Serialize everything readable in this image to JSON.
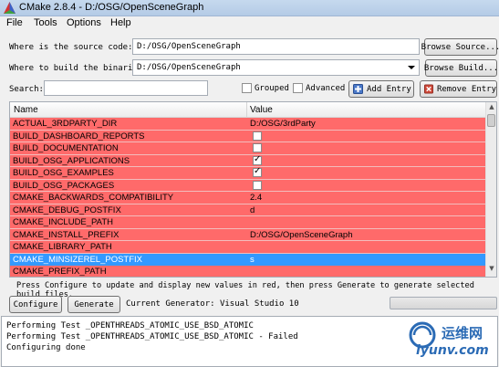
{
  "window": {
    "title": "CMake 2.8.4 - D:/OSG/OpenSceneGraph"
  },
  "menu": [
    "File",
    "Tools",
    "Options",
    "Help"
  ],
  "source": {
    "label": "Where is the source code:",
    "value": "D:/OSG/OpenSceneGraph",
    "button": "Browse Source..."
  },
  "build": {
    "label": "Where to build the binaries:",
    "value": "D:/OSG/OpenSceneGraph",
    "button": "Browse Build..."
  },
  "search": {
    "label": "Search:",
    "value": ""
  },
  "options": {
    "grouped": "Grouped",
    "advanced": "Advanced",
    "add_entry": "Add Entry",
    "remove_entry": "Remove Entry"
  },
  "table": {
    "headers": {
      "name": "Name",
      "value": "Value"
    },
    "rows": [
      {
        "name": "ACTUAL_3RDPARTY_DIR",
        "value": "D:/OSG/3rdParty"
      },
      {
        "name": "BUILD_DASHBOARD_REPORTS",
        "checkbox": false
      },
      {
        "name": "BUILD_DOCUMENTATION",
        "checkbox": false
      },
      {
        "name": "BUILD_OSG_APPLICATIONS",
        "checkbox": true
      },
      {
        "name": "BUILD_OSG_EXAMPLES",
        "checkbox": true
      },
      {
        "name": "BUILD_OSG_PACKAGES",
        "checkbox": false
      },
      {
        "name": "CMAKE_BACKWARDS_COMPATIBILITY",
        "value": "2.4"
      },
      {
        "name": "CMAKE_DEBUG_POSTFIX",
        "value": "d"
      },
      {
        "name": "CMAKE_INCLUDE_PATH",
        "value": ""
      },
      {
        "name": "CMAKE_INSTALL_PREFIX",
        "value": "D:/OSG/OpenSceneGraph"
      },
      {
        "name": "CMAKE_LIBRARY_PATH",
        "value": ""
      },
      {
        "name": "CMAKE_MINSIZEREL_POSTFIX",
        "value": "s",
        "selected": true
      },
      {
        "name": "CMAKE_PREFIX_PATH",
        "value": ""
      }
    ]
  },
  "hint": "Press Configure to update and display new values in red, then press Generate to generate selected build files.",
  "actions": {
    "configure": "Configure",
    "generate": "Generate",
    "generator_label": "Current Generator: Visual Studio 10"
  },
  "output": [
    "Performing Test _OPENTHREADS_ATOMIC_USE_BSD_ATOMIC",
    "Performing Test _OPENTHREADS_ATOMIC_USE_BSD_ATOMIC - Failed",
    "Configuring done"
  ],
  "watermark": {
    "top": "运维网",
    "bottom": "iyunv.com"
  },
  "colors": {
    "changed_row": "#ff6a6a",
    "selected_row": "#3399ff"
  }
}
